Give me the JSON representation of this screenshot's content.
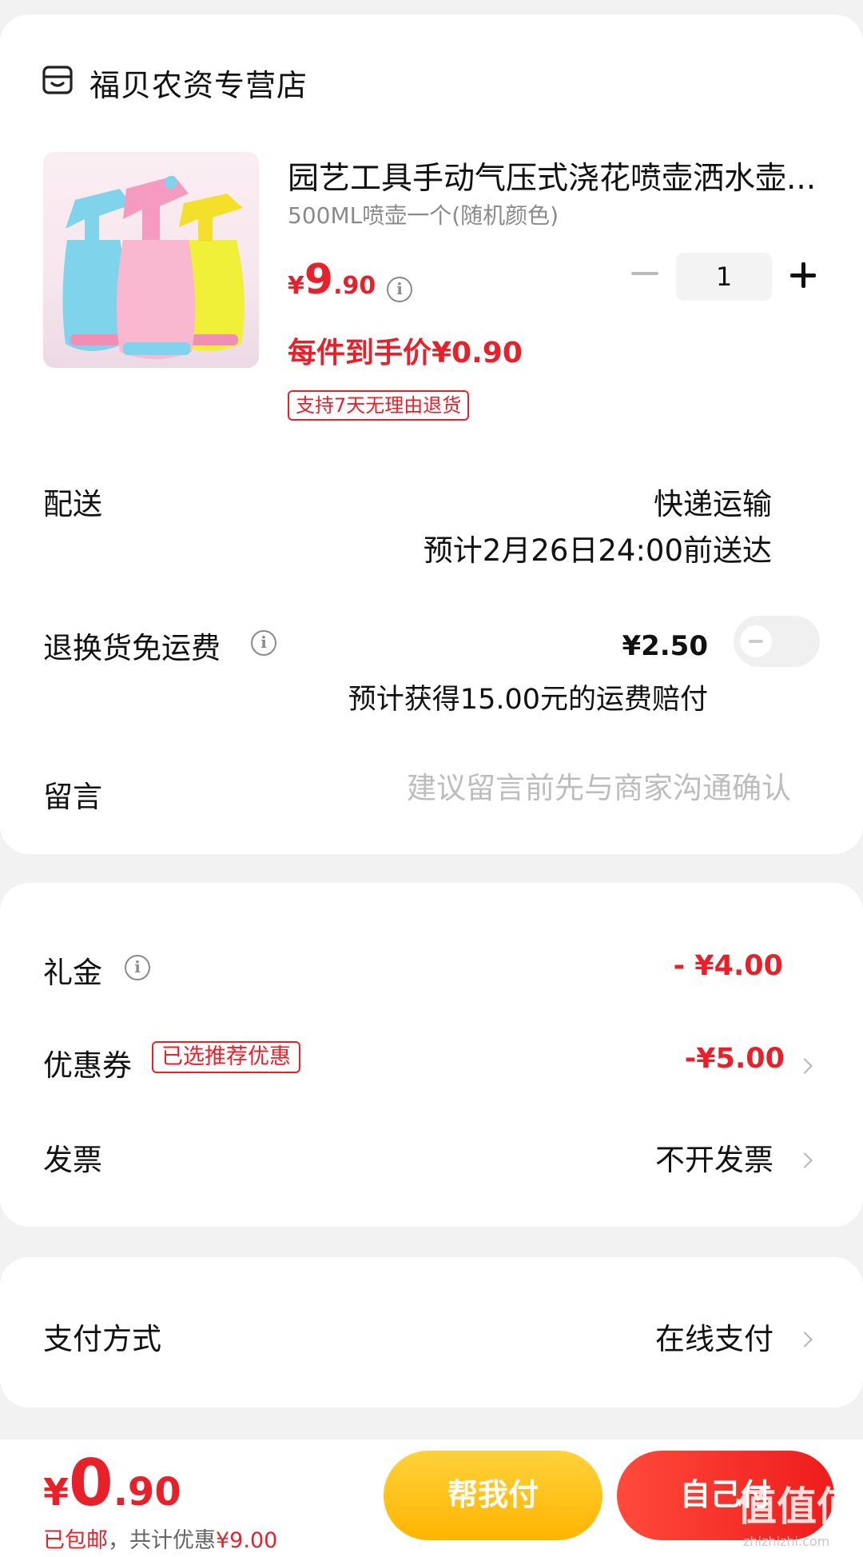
{
  "store": {
    "name": "福贝农资专营店",
    "icon": "store-icon"
  },
  "product": {
    "title": "园艺工具手动气压式浇花喷壶洒水壶...",
    "spec": "500ML喷壶一个(随机颜色)",
    "price_yen": "¥",
    "price_int": "9",
    "price_dec": ".90",
    "unit_price": "每件到手价¥0.90",
    "quantity": "1",
    "return_tag": "支持7天无理由退货",
    "image_icon": "spray-bottle-image"
  },
  "delivery": {
    "label": "配送",
    "method": "快递运输",
    "eta": "预计2月26日24:00前送达"
  },
  "freight": {
    "label": "退换货免运费",
    "price": "¥2.50",
    "note": "预计获得15.00元的运费赔付",
    "enabled": false
  },
  "message": {
    "label": "留言",
    "placeholder": "建议留言前先与商家沟通确认"
  },
  "gift": {
    "label": "礼金",
    "value": "- ¥4.00"
  },
  "coupon": {
    "label": "优惠券",
    "tag": "已选推荐优惠",
    "value": "-¥5.00"
  },
  "invoice": {
    "label": "发票",
    "value": "不开发票"
  },
  "payment": {
    "label": "支付方式",
    "value": "在线支付"
  },
  "footer": {
    "total_yen": "¥",
    "total_int": "0",
    "total_dec": ".90",
    "shipping": "已包邮",
    "sep": "，共计优惠",
    "discount": "¥9.00",
    "help_pay": "帮我付",
    "self_pay": "自己付",
    "watermark": "值值值",
    "watermark_site": "zhizhizhi.com"
  },
  "colors": {
    "accent": "#e8202a",
    "help_button": "#ffc21a",
    "self_button": "#ee1c1c"
  }
}
